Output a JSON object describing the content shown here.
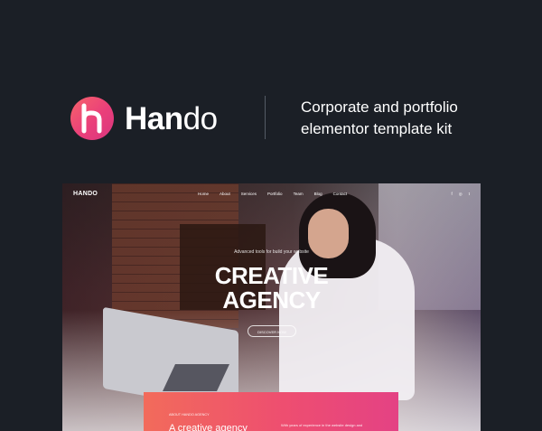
{
  "brand": {
    "name_part1": "Han",
    "name_part2": "do",
    "logo_letter": "h",
    "accent_colors": [
      "#f7646a",
      "#ea3f7a",
      "#d9367f"
    ]
  },
  "tagline": {
    "line1": "Corporate and portfolio",
    "line2": "elementor template kit"
  },
  "preview": {
    "nav_logo": "HANDO",
    "nav_items": [
      "Home",
      "About",
      "Services",
      "Portfolio",
      "Team",
      "Blog",
      "Contact"
    ],
    "social_icons": [
      "facebook-icon",
      "instagram-icon",
      "twitter-icon"
    ],
    "social_glyphs": [
      "f",
      "◎",
      "t"
    ],
    "hero_kicker": "Advanced tools for build your website",
    "hero_title_line1": "CREATIVE",
    "hero_title_line2": "AGENCY",
    "hero_button": "DISCOVER NOW",
    "about_kicker": "ABOUT HANDO AGENCY",
    "about_title": "A creative agency",
    "about_text": "With years of experience in the website design and"
  }
}
